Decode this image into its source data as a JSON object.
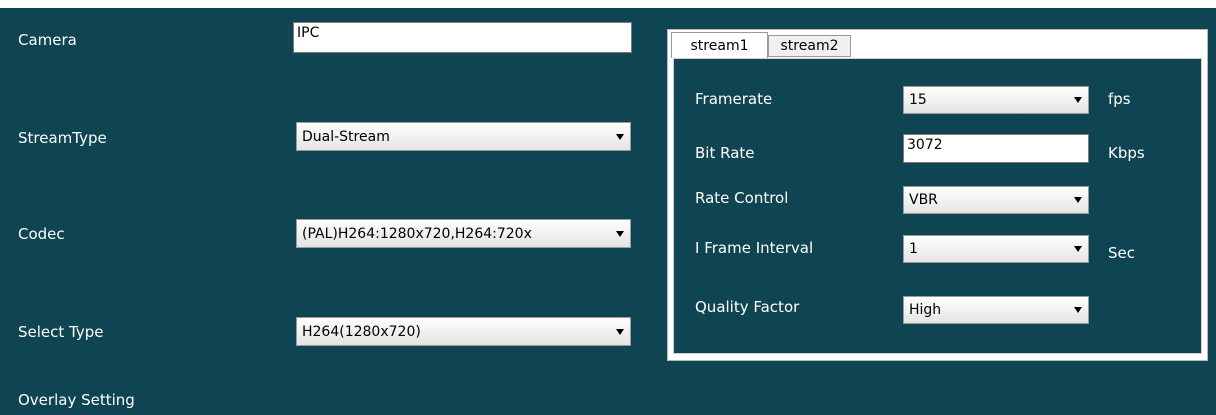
{
  "form": {
    "camera_label": "Camera",
    "camera_value": "IPC",
    "streamtype_label": "StreamType",
    "streamtype_value": "Dual-Stream",
    "codec_label": "Codec",
    "codec_value": "(PAL)H264:1280x720,H264:720x",
    "selecttype_label": "Select Type",
    "selecttype_value": "H264(1280x720)",
    "overlay_label": "Overlay Setting"
  },
  "tabs": [
    {
      "label": "stream1",
      "active": true
    },
    {
      "label": "stream2",
      "active": false
    }
  ],
  "stream": {
    "framerate_label": "Framerate",
    "framerate_value": "15",
    "framerate_unit": "fps",
    "bitrate_label": "Bit Rate",
    "bitrate_value": "3072",
    "bitrate_unit": "Kbps",
    "ratecontrol_label": "Rate Control",
    "ratecontrol_value": "VBR",
    "iframe_label": "I Frame Interval",
    "iframe_value": "1",
    "iframe_unit": "Sec",
    "quality_label": "Quality Factor",
    "quality_value": "High"
  },
  "colors": {
    "panel_bg": "#0f4452",
    "field_bg": "#ffffff",
    "label_text": "#ffffff"
  },
  "icons": {
    "dropdown": "chevron-down-icon"
  }
}
